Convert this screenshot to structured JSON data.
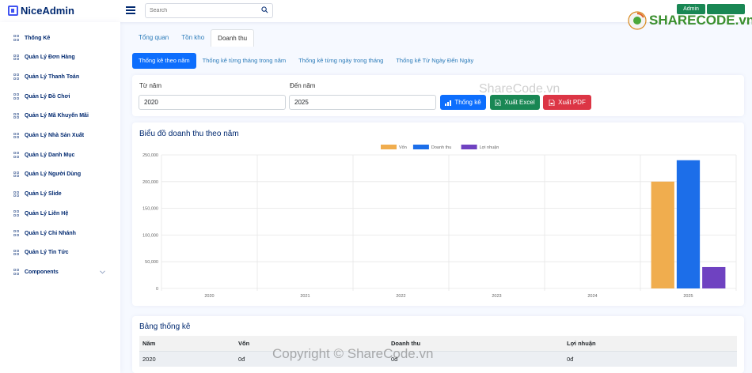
{
  "header": {
    "logo_text": "NiceAdmin",
    "search_placeholder": "Search",
    "admin_label": "Admin"
  },
  "sidebar": {
    "items": [
      {
        "label": "Thống Kê"
      },
      {
        "label": "Quản Lý Đơn Hàng"
      },
      {
        "label": "Quản Lý Thanh Toán"
      },
      {
        "label": "Quản Lý Đồ Chơi"
      },
      {
        "label": "Quản Lý Mã Khuyến Mãi"
      },
      {
        "label": "Quản Lý Nhà Sản Xuất"
      },
      {
        "label": "Quản Lý Danh Mục"
      },
      {
        "label": "Quản Lý Người Dùng"
      },
      {
        "label": "Quản Lý Slide"
      },
      {
        "label": "Quản Lý Liên Hệ"
      },
      {
        "label": "Quản Lý Chi Nhánh"
      },
      {
        "label": "Quản Lý Tin Tức"
      },
      {
        "label": "Components"
      }
    ]
  },
  "tabs": [
    "Tổng quan",
    "Tồn kho",
    "Doanh thu"
  ],
  "active_tab": 2,
  "pills": [
    "Thống kê theo năm",
    "Thống kê từng tháng trong năm",
    "Thống kê từng ngày trong tháng",
    "Thống kê Từ Ngày Đến Ngày"
  ],
  "active_pill": 0,
  "filter": {
    "from_label": "Từ năm",
    "from_value": "2020",
    "to_label": "Đến năm",
    "to_value": "2025",
    "btn_stats": "Thống kê",
    "btn_excel": "Xuất Excel",
    "btn_pdf": "Xuất PDF"
  },
  "chart_card_title": "Biểu đồ doanh thu theo năm",
  "chart_data": {
    "type": "bar",
    "categories": [
      "2020",
      "2021",
      "2022",
      "2023",
      "2024",
      "2025"
    ],
    "series": [
      {
        "name": "Vốn",
        "color": "#f0ad4e",
        "values": [
          0,
          0,
          0,
          0,
          0,
          200000
        ]
      },
      {
        "name": "Doanh thu",
        "color": "#1c6ee9",
        "values": [
          0,
          0,
          0,
          0,
          0,
          240000
        ]
      },
      {
        "name": "Lợi nhuận",
        "color": "#6f42c1",
        "values": [
          0,
          0,
          0,
          0,
          0,
          40000
        ]
      }
    ],
    "yticks": [
      "0",
      "50,000",
      "100,000",
      "150,000",
      "200,000",
      "250,000"
    ],
    "ylim": [
      0,
      250000
    ],
    "grid": true,
    "legend": "top-center"
  },
  "table": {
    "title": "Bảng thống kê",
    "columns": [
      "Năm",
      "Vốn",
      "Doanh thu",
      "Lợi nhuận"
    ],
    "rows": [
      [
        "2020",
        "0đ",
        "0đ",
        "0đ"
      ]
    ]
  },
  "watermarks": {
    "center": "ShareCode.vn",
    "bottom": "Copyright © ShareCode.vn",
    "logo": "SHARECODE.vn"
  }
}
